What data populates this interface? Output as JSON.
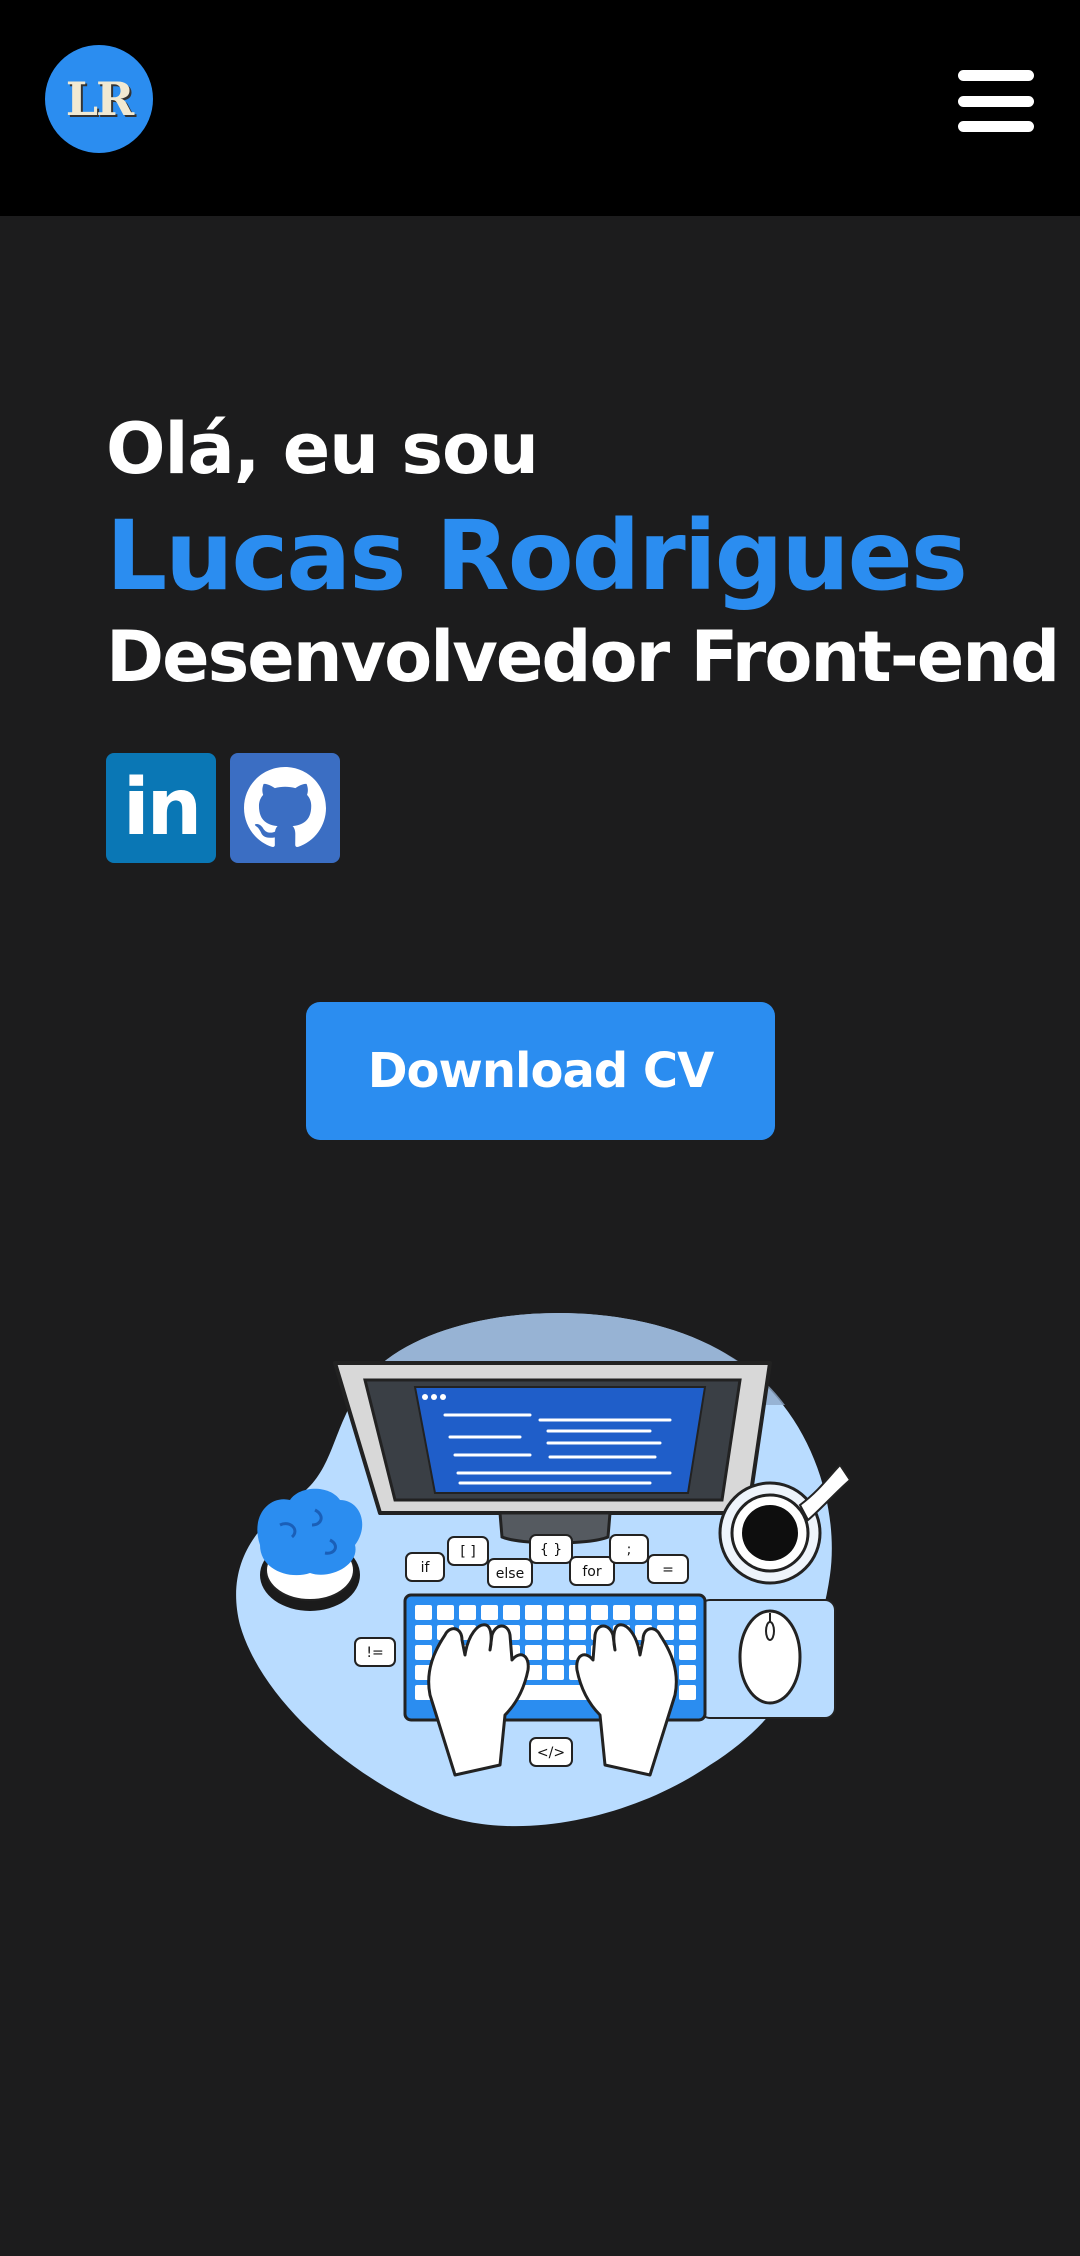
{
  "header": {
    "logo_text": "LR",
    "menu_icon": "hamburger-menu-icon"
  },
  "hero": {
    "greeting": "Olá, eu sou",
    "name": "Lucas Rodrigues",
    "role": "Desenvolvedor Front-end"
  },
  "social": {
    "linkedin": {
      "icon": "linkedin-icon",
      "text": "in"
    },
    "github": {
      "icon": "github-icon"
    }
  },
  "cta": {
    "download_label": "Download CV"
  },
  "illustration": {
    "labels": [
      "if",
      "[ ]",
      "else",
      "{ }",
      "for",
      ";",
      "=",
      "!=",
      "</>"
    ]
  },
  "colors": {
    "accent": "#2b8df0",
    "header_bg": "#000000",
    "page_bg": "#1c1c1d",
    "linkedin": "#0a77b5",
    "github": "#3b6ec3"
  }
}
